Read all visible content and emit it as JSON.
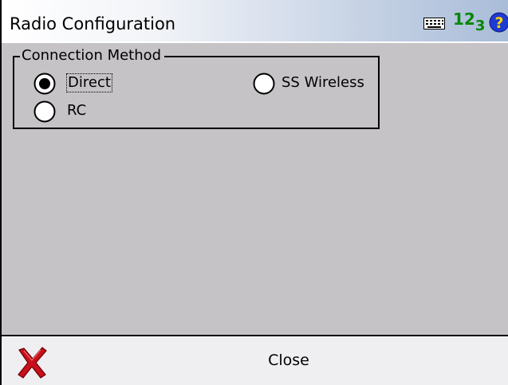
{
  "window": {
    "title": "Radio Configuration"
  },
  "status_icons": {
    "keyboard": "keyboard-icon",
    "input_mode": {
      "main": "12",
      "sub": "3"
    },
    "help": "help-icon"
  },
  "connection_group": {
    "legend": "Connection Method",
    "options": [
      {
        "label": "Direct",
        "selected": true,
        "focused": true
      },
      {
        "label": "SS Wireless",
        "selected": false,
        "focused": false
      },
      {
        "label": "RC",
        "selected": false,
        "focused": false
      }
    ]
  },
  "bottom_bar": {
    "cancel_icon": "red-x-icon",
    "close_label": "Close"
  },
  "colors": {
    "background": "#c6c3c6",
    "bottom_bar": "#efeef0",
    "input_mode": "#008800",
    "help": "#1f3bd1",
    "cancel": "#c8101a"
  }
}
